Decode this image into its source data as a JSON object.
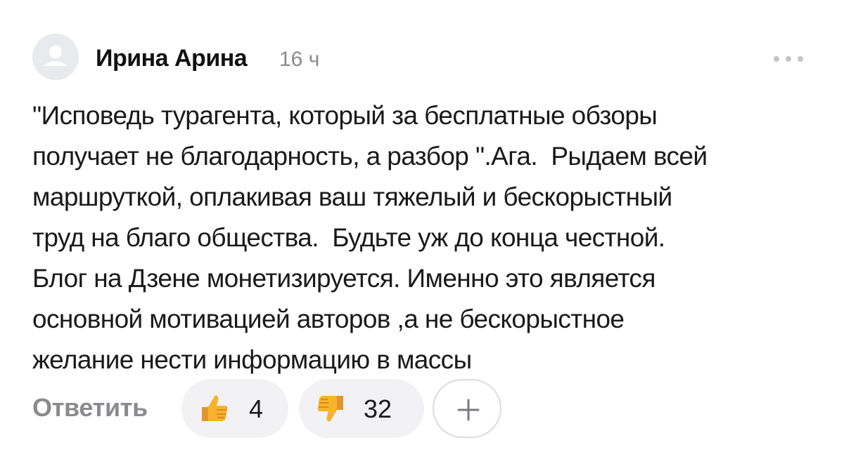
{
  "comment": {
    "author": "Ирина Арина",
    "time": "16 ч",
    "text_lines": [
      "\"Исповедь турагента, который за бесплатные обзоры",
      "получает не благодарность, а разбор \".Ага.  Рыдаем всей",
      "маршруткой, оплакивая ваш тяжелый и бескорыстный",
      "труд на благо общества.  Будьте уж до конца честной.",
      "Блог на Дзене монетизируется. Именно это является",
      "основной мотивацией авторов ,а не бескорыстное",
      "желание нести информацию в массы"
    ],
    "avatar_icon": "user-placeholder-icon",
    "more_icon": "more-dots-icon"
  },
  "actions": {
    "reply_label": "Ответить",
    "likes": {
      "icon": "thumbs-up-emoji-icon",
      "count": "4"
    },
    "dislikes": {
      "icon": "thumbs-down-emoji-icon",
      "count": "32"
    },
    "add_reaction_icon": "plus-icon"
  },
  "colors": {
    "text": "#1a1a1a",
    "muted": "#8a8a8f",
    "pill_bg": "#f2f2f4",
    "avatar_bg": "#e9eaed",
    "emoji_yellow": "#f7b32b"
  }
}
